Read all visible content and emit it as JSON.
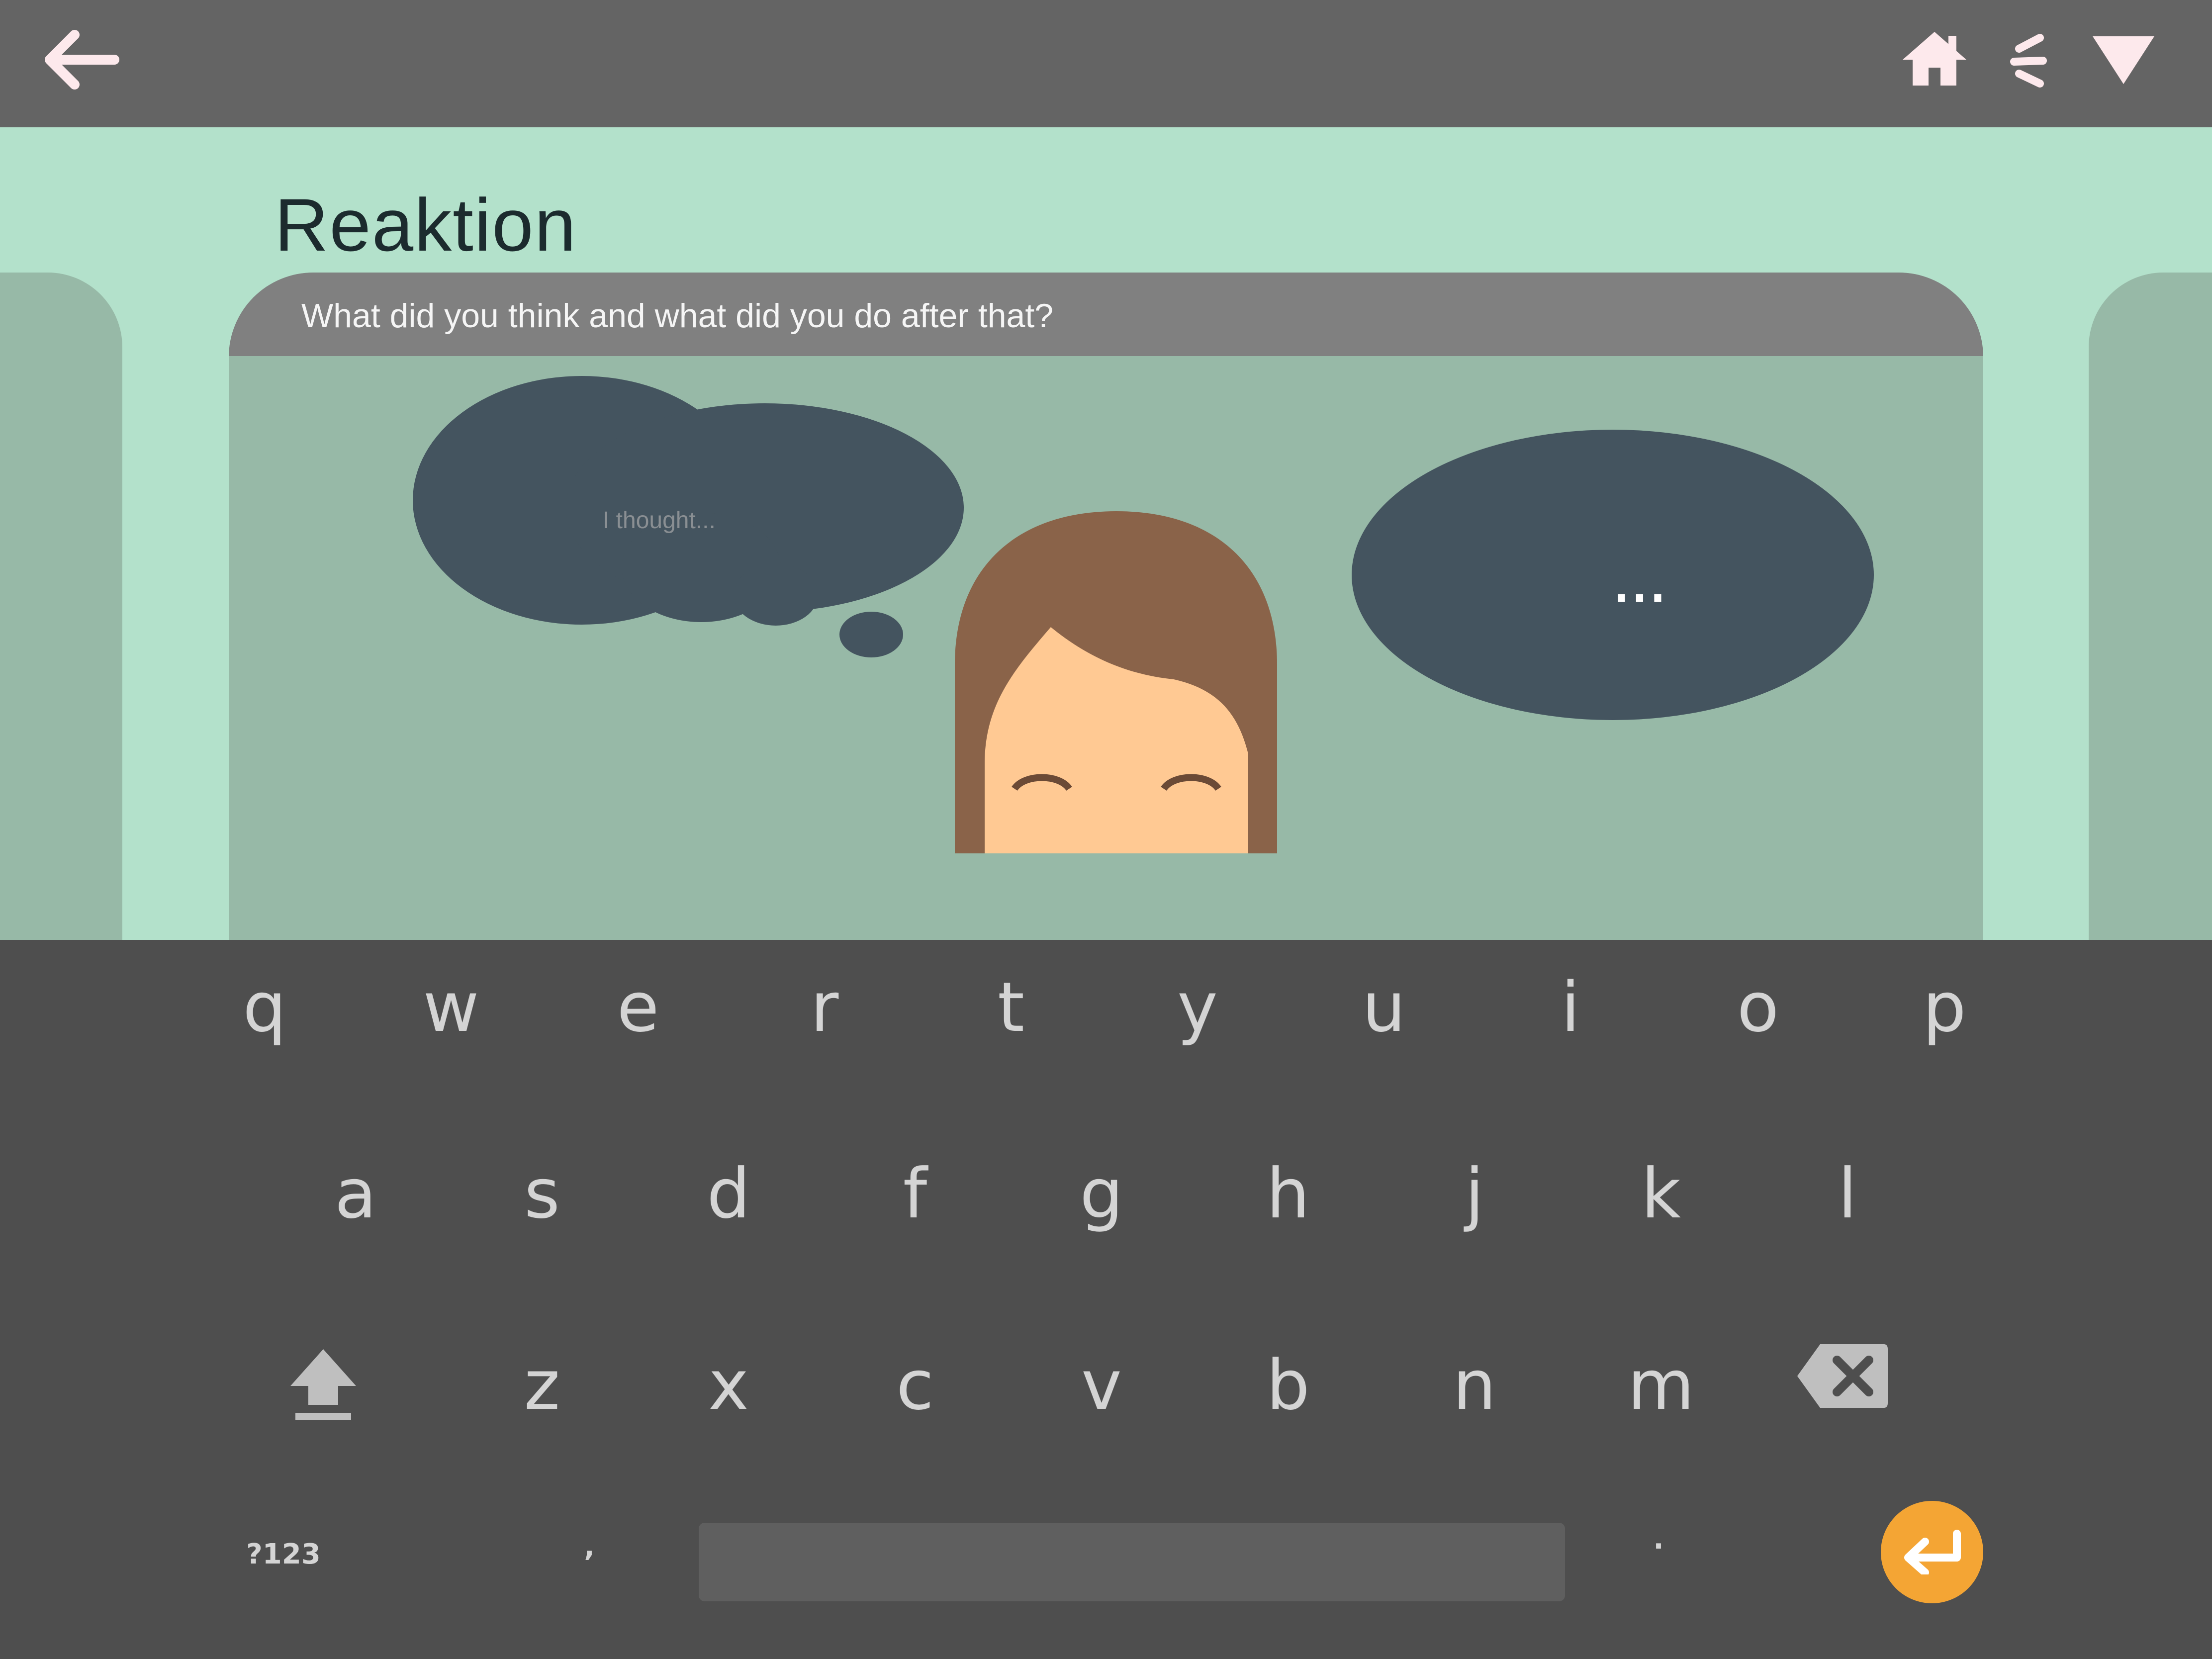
{
  "topbar": {
    "back_icon": "arrow-left-icon",
    "home_icon": "home-icon",
    "menu_icon": "menu-lines-icon",
    "dropdown_icon": "triangle-down-icon",
    "icon_color": "#fde9ec"
  },
  "page": {
    "title": "Reaktion"
  },
  "card": {
    "question": "What did you think and what did you do after that?",
    "thought_placeholder": "I thought...",
    "thought_value": "",
    "speech_text": "..."
  },
  "keyboard": {
    "row1": [
      "q",
      "w",
      "e",
      "r",
      "t",
      "y",
      "u",
      "i",
      "o",
      "p"
    ],
    "row2": [
      "a",
      "s",
      "d",
      "f",
      "g",
      "h",
      "j",
      "k",
      "l"
    ],
    "row3": [
      "z",
      "x",
      "c",
      "v",
      "b",
      "n",
      "m"
    ],
    "symbols_label": "?123",
    "comma_label": ",",
    "period_label": ".",
    "shift_icon": "shift-icon",
    "backspace_icon": "backspace-icon",
    "enter_icon": "enter-icon",
    "enter_color": "#f4a534"
  },
  "colors": {
    "topbar": "#646464",
    "background": "#b3e1cb",
    "card": "#97b9a7",
    "card_header": "#808080",
    "bubble": "#44545f",
    "keyboard": "#4e4e4e"
  }
}
